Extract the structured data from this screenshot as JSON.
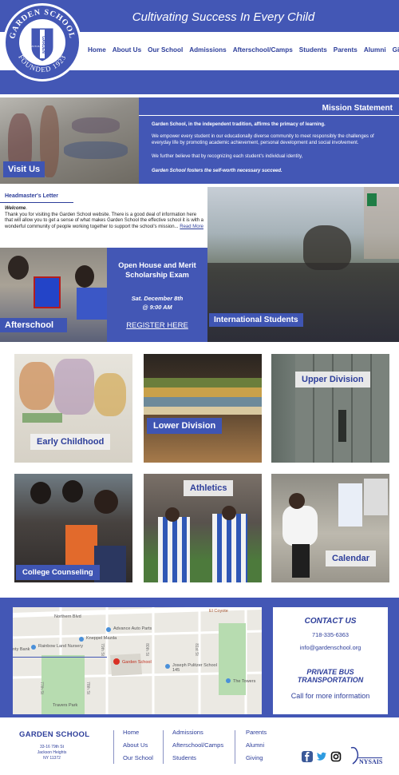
{
  "header": {
    "tagline": "Cultivating Success In Every Child",
    "logo": {
      "top_text": "GARDEN SCHOOL",
      "bottom_text": "FOUNDED 1923",
      "shield_text": "GARDEN",
      "shield_side": "VICTUS"
    },
    "nav": [
      "Home",
      "About Us",
      "Our School",
      "Admissions",
      "Afterschool/Camps",
      "Students",
      "Parents",
      "Alumni",
      "Giving"
    ]
  },
  "hero": {
    "visit_label": "Visit Us",
    "mission_title": "Mission Statement",
    "mission_p1": "Garden School, in the independent tradition, affirms the primacy of learning.",
    "mission_p2": "We empower every student in our educationally diverse community to meet responsibly the challenges of everyday life by promoting academic achievement, personal development and social involvement.",
    "mission_p3": "We further believe that by recognizing each student's individual identity,",
    "mission_p4": "Garden School fosters the self-worth necessary succeed."
  },
  "headmaster": {
    "title": "Headmaster's Letter",
    "welcome": "Welcome",
    "text": "Thank you for visiting the Garden School website. There is a good deal of information here that will allow you to get a sense of what makes Garden School the effective school it is with a wonderful community of people working together to support the school's mission...",
    "read_more": "Read More"
  },
  "promo": {
    "afterschool_label": "Afterschool",
    "openhouse_title": "Open House and Merit Scholarship Exam",
    "openhouse_date": "Sat. December 8th",
    "openhouse_time": "@ 9:00 AM",
    "register_link": "REGISTER HERE",
    "international_label": "International Students"
  },
  "tiles": [
    {
      "label": "Early Childhood"
    },
    {
      "label": "Lower Division"
    },
    {
      "label": "Upper Division"
    },
    {
      "label": "College Counseling"
    },
    {
      "label": "Athletics"
    },
    {
      "label": "Calendar"
    }
  ],
  "map": {
    "labels": [
      "Northern Blvd",
      "Advance Auto Parts",
      "Kneppel Mazda",
      "Rainbow Land Nursery",
      "Garden School",
      "Joseph Pulitzer School 145",
      "The Towers",
      "Travers Park",
      "El Coyote",
      "nty Bank",
      "77th St",
      "78th St",
      "79th St",
      "80th St",
      "81st St"
    ]
  },
  "contact": {
    "title": "CONTACT US",
    "phone": "718-335-6363",
    "email": "info@gardenschool.org",
    "bus_title": "PRIVATE BUS TRANSPORTATION",
    "bus_text": "Call for more information"
  },
  "footer": {
    "school": "GARDEN SCHOOL",
    "addr1": "33-16 79th St",
    "addr2": "Jackson Heights",
    "addr3": "NY 11372",
    "col1": [
      "Home",
      "About Us",
      "Our School"
    ],
    "col2": [
      "Admissions",
      "Afterschool/Camps",
      "Students"
    ],
    "col3": [
      "Parents",
      "Alumni",
      "Giving"
    ],
    "badge": "NYSAIS",
    "colors": {
      "brand": "#4357b5",
      "link": "#2d3e9a"
    }
  }
}
